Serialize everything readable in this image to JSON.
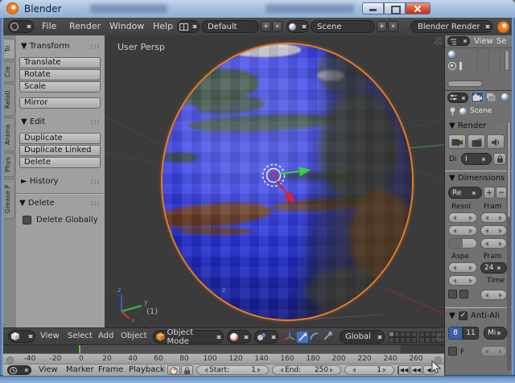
{
  "ui": {
    "tri_down": "▼",
    "tri_right": "►",
    "plus": "+",
    "close": "✕",
    "minus": "−",
    "check": "✓",
    "rewind": "◀◀",
    "play_back": "◀"
  },
  "window": {
    "title": "Blender"
  },
  "topbar": {
    "menus": [
      "File",
      "Render",
      "Window",
      "Help"
    ],
    "layout_value": "Default",
    "scene_value": "Scene",
    "engine": "Blender Render"
  },
  "shelf": {
    "tabs": [
      "To",
      "Cre",
      "Relati",
      "Anima",
      "Phys",
      "Grease P"
    ],
    "transform": {
      "title": "Transform",
      "buttons": [
        "Translate",
        "Rotate",
        "Scale"
      ],
      "mirror": "Mirror"
    },
    "edit": {
      "title": "Edit",
      "buttons": [
        "Duplicate",
        "Duplicate Linked",
        "Delete"
      ]
    },
    "history": {
      "title": "History"
    },
    "operator": {
      "title": "Delete",
      "option": "Delete Globally",
      "checked": false
    }
  },
  "viewport": {
    "persp_label": "User Persp",
    "object_info": "(1)",
    "axis": {
      "x": "x",
      "y": "y",
      "z": "z"
    },
    "header": {
      "menus": [
        "View",
        "Select",
        "Add",
        "Object"
      ],
      "mode": "Object Mode",
      "orientation": "Global"
    }
  },
  "timeline": {
    "ticks": [
      "-40",
      "-20",
      "0",
      "20",
      "40",
      "60",
      "80",
      "100",
      "120",
      "140",
      "160",
      "180",
      "200",
      "220",
      "240",
      "260"
    ],
    "current_frame": 1,
    "header": {
      "menus": [
        "View",
        "Marker",
        "Frame",
        "Playback"
      ],
      "start_label": "Start:",
      "start_value": "1",
      "end_label": "End:",
      "end_value": "250",
      "frame_value": "1"
    }
  },
  "outliner": {
    "menus": [
      "View",
      "Se"
    ]
  },
  "properties": {
    "context": "Scene",
    "render": {
      "title": "Render",
      "display_label": "Di",
      "display_value": "I"
    },
    "dimensions": {
      "title": "Dimensions",
      "preset": "Re",
      "resolution_label": "Resol",
      "frame_label": "Fram",
      "aspect_label": "Aspe",
      "framerate_label": "Fram",
      "framerate_value": "24",
      "time_label": "Time"
    },
    "antialias": {
      "title": "Anti-Ali",
      "sample_8": "8",
      "sample_11": "11",
      "filter": "Mi",
      "full_label": "F"
    }
  },
  "colors": {
    "selection_outline": "#f5812b",
    "axis_x": "#d04040",
    "axis_y": "#4fb84f",
    "axis_z": "#4158c8",
    "frame_marker": "#62c832",
    "active_tool_blue": "#4a72b8",
    "ocean_blue": "#2430d6",
    "titlebar_blue": "#a7c0e0"
  }
}
